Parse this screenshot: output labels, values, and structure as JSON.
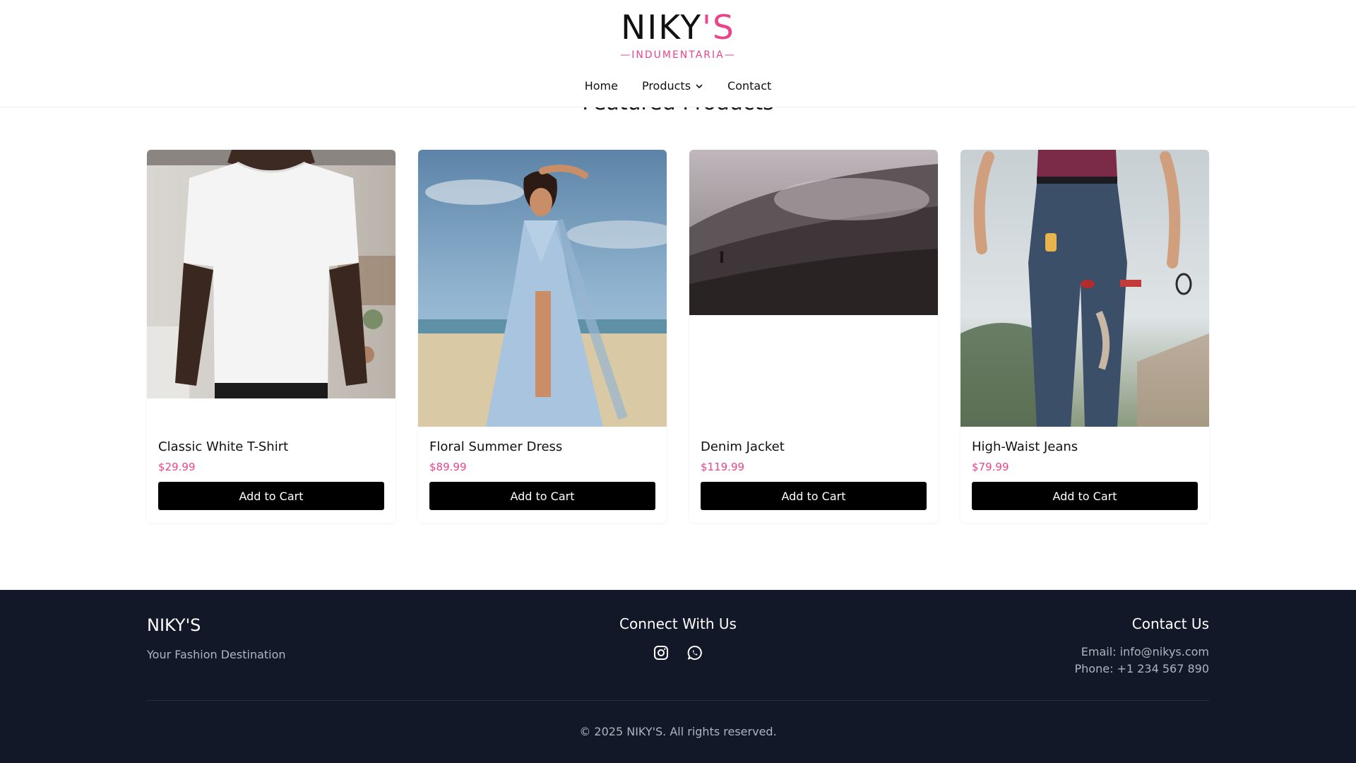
{
  "brand": {
    "logo_part1": "NIKY",
    "logo_part2": "'S",
    "logo_sub": "—INDUMENTARIA—",
    "accent_color": "#e8458b"
  },
  "nav": {
    "home": "Home",
    "products": "Products",
    "contact": "Contact"
  },
  "section": {
    "title": "Featured Products"
  },
  "products": [
    {
      "name": "Classic White T-Shirt",
      "price": "$29.99",
      "button": "Add to Cart"
    },
    {
      "name": "Floral Summer Dress",
      "price": "$89.99",
      "button": "Add to Cart"
    },
    {
      "name": "Denim Jacket",
      "price": "$119.99",
      "button": "Add to Cart"
    },
    {
      "name": "High-Waist Jeans",
      "price": "$79.99",
      "button": "Add to Cart"
    }
  ],
  "footer": {
    "brand": "NIKY'S",
    "tagline": "Your Fashion Destination",
    "connect_title": "Connect With Us",
    "social_icons": [
      "instagram-icon",
      "whatsapp-icon"
    ],
    "contact_title": "Contact Us",
    "email": "Email: info@nikys.com",
    "phone": "Phone: +1 234 567 890",
    "copyright": "© 2025 NIKY'S. All rights reserved.",
    "background_color": "#121827"
  }
}
